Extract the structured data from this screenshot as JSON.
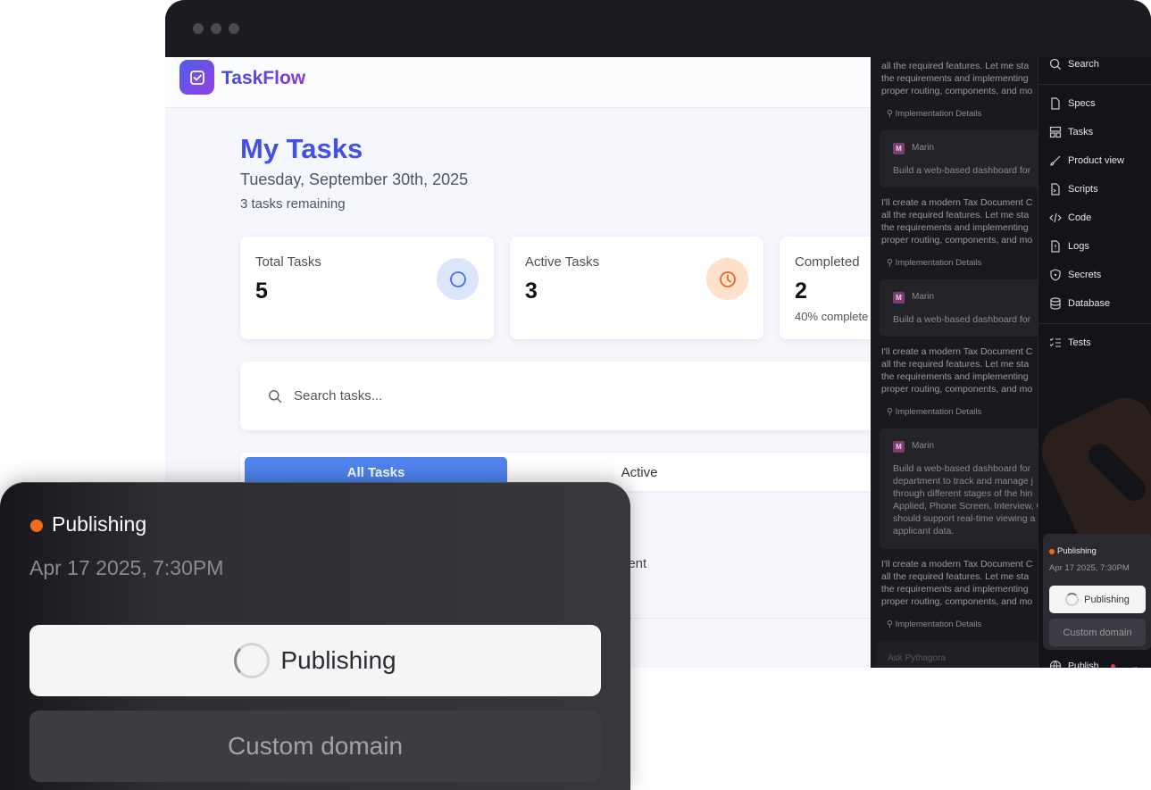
{
  "app": {
    "brand": "TaskFlow",
    "title": "My Tasks",
    "date": "Tuesday, September 30th, 2025",
    "remaining": "3 tasks remaining",
    "stats": [
      {
        "label": "Total Tasks",
        "value": "5",
        "icon": "circle-icon",
        "color": "#4a6ee0"
      },
      {
        "label": "Active Tasks",
        "value": "3",
        "icon": "clock-icon",
        "color": "#e8682a"
      },
      {
        "label": "Completed",
        "value": "2",
        "sub": "40% complete"
      }
    ],
    "search_placeholder": "Search tasks...",
    "tabs": [
      "All Tasks",
      "Active"
    ],
    "task_snippet": "ient"
  },
  "chat": {
    "ai_text": "all the required features. Let me sta\nthe requirements and implementing\nproper routing, components, and mo",
    "ai_text_full": "I'll create a modern Tax Document C\nall the required features. Let me sta\nthe requirements and implementing\nproper routing, components, and mo",
    "impl": "Implementation Details",
    "user_name": "Marin",
    "user_initial": "M",
    "user_short": "Build a web-based dashboard for",
    "user_long": "Build a web-based dashboard for\ndepartment to track and manage j\nthrough different stages of the hiri\nApplied, Phone Screen, Interview, C\nshould support real-time viewing a\napplicant data.",
    "ask_placeholder": "Ask Pythagora"
  },
  "sidebar": {
    "items": [
      "Search",
      "Specs",
      "Tasks",
      "Product view",
      "Scripts",
      "Code",
      "Logs",
      "Secrets",
      "Database",
      "Tests"
    ],
    "publish": {
      "status": "Publishing",
      "date": "Apr 17 2025, 7:30PM",
      "button": "Publishing",
      "custom_domain": "Custom domain",
      "footer": "Publish"
    }
  },
  "overlay": {
    "status": "Publishing",
    "date": "Apr 17 2025, 7:30PM",
    "button": "Publishing",
    "custom_domain": "Custom domain",
    "accent": "#f26b1d"
  }
}
